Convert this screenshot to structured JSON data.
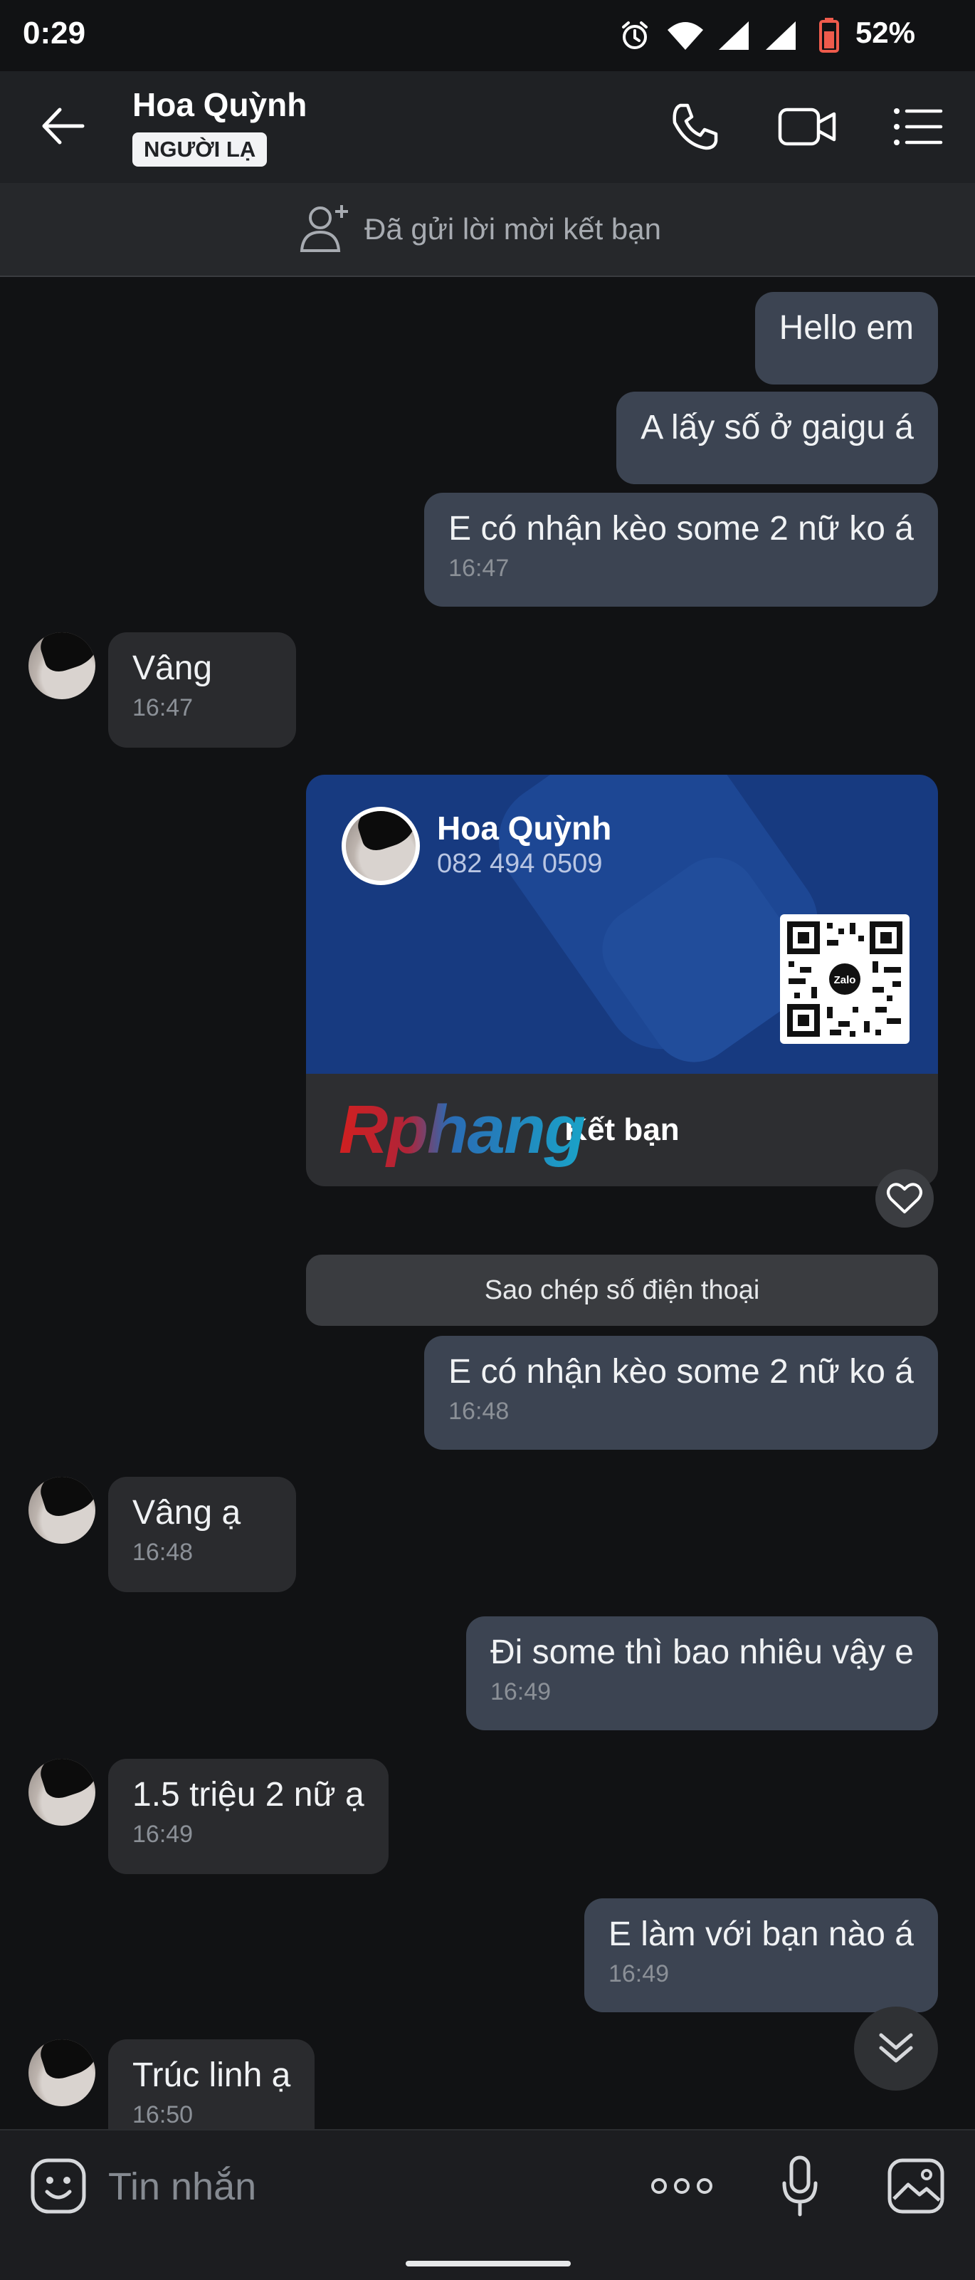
{
  "status_bar": {
    "time": "0:29",
    "battery": "52%"
  },
  "header": {
    "title": "Hoa Quỳnh",
    "badge": "NGƯỜI LẠ"
  },
  "friend_request": {
    "text": "Đã gửi lời mời kết bạn"
  },
  "messages": [
    {
      "dir": "out",
      "text": "Hello em"
    },
    {
      "dir": "out",
      "text": "A lấy số ở gaigu á"
    },
    {
      "dir": "out",
      "text": "E có nhận kèo some 2 nữ ko á",
      "time": "16:47"
    },
    {
      "dir": "in",
      "text": "Vâng",
      "time": "16:47"
    },
    {
      "dir": "out",
      "text": "E có nhận kèo some 2 nữ ko á",
      "time": "16:48"
    },
    {
      "dir": "in",
      "text": "Vâng ạ",
      "time": "16:48"
    },
    {
      "dir": "out",
      "text": "Đi some thì bao nhiêu vậy e",
      "time": "16:49"
    },
    {
      "dir": "in",
      "text": "1.5 triệu 2 nữ ạ",
      "time": "16:49"
    },
    {
      "dir": "out",
      "text": "E làm với bạn nào á",
      "time": "16:49"
    },
    {
      "dir": "in",
      "text": "Trúc linh ạ",
      "time": "16:50"
    }
  ],
  "contact_card": {
    "name": "Hoa Quỳnh",
    "phone": "082 494 0509",
    "qr_logo": "Zalo",
    "add_friend": "Kết bạn",
    "watermark": "Rphang"
  },
  "copy_phone": "Sao chép số điện thoại",
  "input": {
    "placeholder": "Tin nhắn"
  },
  "icons": [
    "back-arrow-icon",
    "phone-icon",
    "video-call-icon",
    "menu-icon",
    "add-friend-icon",
    "heart-icon",
    "chevron-down-icon",
    "emoji-icon",
    "more-icon",
    "microphone-icon",
    "image-icon",
    "alarm-icon",
    "wifi-icon",
    "signal-icon",
    "battery-icon"
  ],
  "colors": {
    "background": "#111214",
    "header": "#1f2124",
    "outgoing": "#3c4452",
    "incoming": "#2a2b2e",
    "card": "#173a80"
  }
}
